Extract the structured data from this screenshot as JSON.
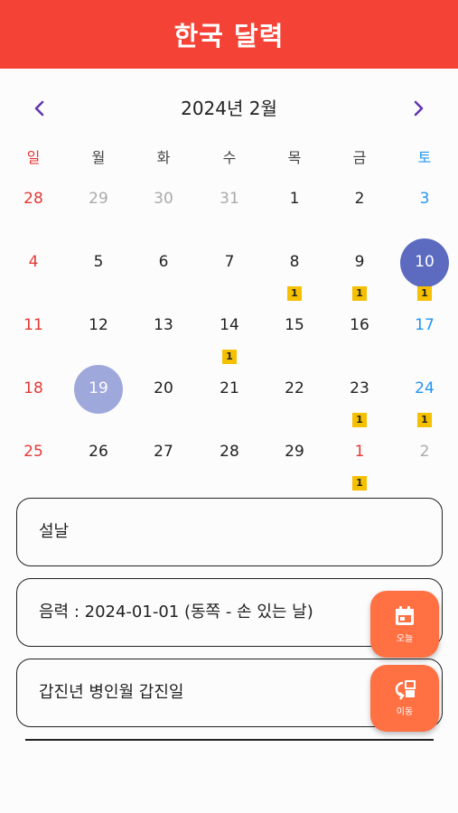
{
  "app": {
    "title": "한국 달력"
  },
  "nav": {
    "month_label": "2024년 2월"
  },
  "weekdays": [
    "일",
    "월",
    "화",
    "수",
    "목",
    "금",
    "토"
  ],
  "calendar": {
    "weeks": [
      [
        {
          "d": "28",
          "out": true
        },
        {
          "d": "29",
          "out": true
        },
        {
          "d": "30",
          "out": true
        },
        {
          "d": "31",
          "out": true
        },
        {
          "d": "1"
        },
        {
          "d": "2"
        },
        {
          "d": "3"
        }
      ],
      [
        {
          "d": "4"
        },
        {
          "d": "5"
        },
        {
          "d": "6"
        },
        {
          "d": "7"
        },
        {
          "d": "8",
          "badge": "1"
        },
        {
          "d": "9",
          "badge": "1"
        },
        {
          "d": "10",
          "badge": "1",
          "selected": true
        }
      ],
      [
        {
          "d": "11"
        },
        {
          "d": "12"
        },
        {
          "d": "13"
        },
        {
          "d": "14",
          "badge": "1"
        },
        {
          "d": "15"
        },
        {
          "d": "16"
        },
        {
          "d": "17"
        }
      ],
      [
        {
          "d": "18"
        },
        {
          "d": "19",
          "today": true
        },
        {
          "d": "20"
        },
        {
          "d": "21"
        },
        {
          "d": "22"
        },
        {
          "d": "23",
          "badge": "1"
        },
        {
          "d": "24",
          "badge": "1"
        }
      ],
      [
        {
          "d": "25"
        },
        {
          "d": "26"
        },
        {
          "d": "27"
        },
        {
          "d": "28"
        },
        {
          "d": "29"
        },
        {
          "d": "1",
          "out": true,
          "badge": "1",
          "holiday": true
        },
        {
          "d": "2",
          "out": true
        }
      ]
    ]
  },
  "colors": {
    "appbar": "#f44336",
    "sunday": "#e53935",
    "saturday": "#2196f3",
    "outside": "#aaaaaa",
    "selected_circle": "#5c6bc0",
    "today_circle": "#9fa8da",
    "badge": "#f5c000",
    "fab": "#ff7043",
    "nav_arrow": "#5e35b1"
  },
  "details": {
    "event_name": "설날",
    "lunar": "음력 : 2024-01-01 (동쪽 - 손 있는 날)",
    "ganji": "갑진년 병인월 갑진일"
  },
  "fabs": {
    "today_label": "오늘",
    "move_label": "이동"
  },
  "icons": {
    "prev": "chevron-left-icon",
    "next": "chevron-right-icon",
    "today": "calendar-icon",
    "move": "swap-icon"
  }
}
